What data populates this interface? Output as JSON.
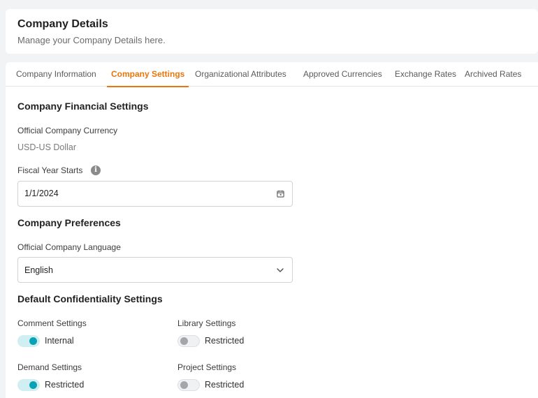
{
  "header": {
    "title": "Company Details",
    "subtitle": "Manage your Company Details here."
  },
  "tabs": [
    {
      "label": "Company Information"
    },
    {
      "label": "Company Settings",
      "active": true
    },
    {
      "label": "Organizational Attributes"
    },
    {
      "label": "Approved Currencies"
    },
    {
      "label": "Exchange Rates"
    },
    {
      "label": "Archived Rates"
    }
  ],
  "financial": {
    "title": "Company Financial Settings",
    "currency_label": "Official Company Currency",
    "currency_value": "USD-US Dollar",
    "fiscal_label": "Fiscal Year Starts",
    "fiscal_value": "1/1/2024"
  },
  "preferences": {
    "title": "Company Preferences",
    "language_label": "Official Company Language",
    "language_value": "English"
  },
  "confidentiality": {
    "title": "Default Confidentiality Settings",
    "settings": [
      {
        "label": "Comment Settings",
        "value": "Internal",
        "enabled": true
      },
      {
        "label": "Library Settings",
        "value": "Restricted",
        "enabled": false
      },
      {
        "label": "Demand Settings",
        "value": "Restricted",
        "enabled": true
      },
      {
        "label": "Project Settings",
        "value": "Restricted",
        "enabled": false
      }
    ]
  },
  "colors": {
    "accent": "#e8760c",
    "toggle_on": "#0aa2b4"
  },
  "icons": {
    "info": "info-icon",
    "calendar": "calendar-icon",
    "dropdown": "chevron-down-icon"
  }
}
